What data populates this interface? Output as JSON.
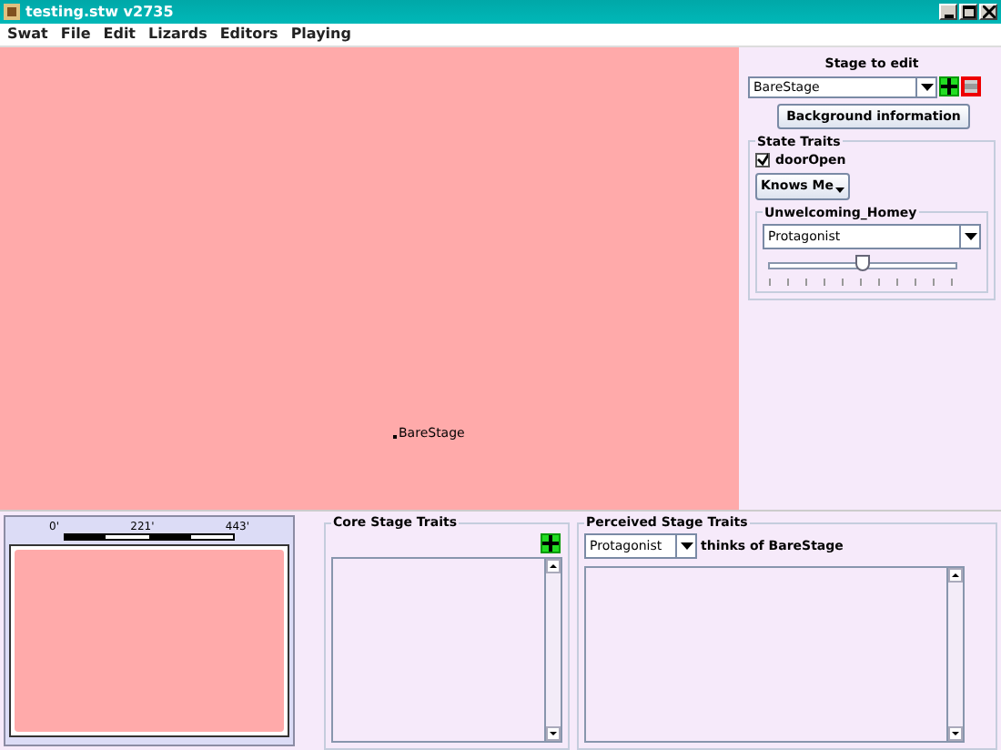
{
  "window": {
    "title": "testing.stw v2735"
  },
  "menu": [
    "Swat",
    "File",
    "Edit",
    "Lizards",
    "Editors",
    "Playing"
  ],
  "canvas": {
    "nodes": [
      {
        "label": "BareStage"
      }
    ]
  },
  "stage_panel": {
    "heading": "Stage to edit",
    "stage_value": "BareStage",
    "background_button": "Background information"
  },
  "state_traits": {
    "title": "State Traits",
    "checkbox": {
      "label": "doorOpen",
      "checked": true
    },
    "knows_button": "Knows Me",
    "trait": {
      "title": "Unwelcoming_Homey",
      "actor": "Protagonist",
      "level": 0.5
    }
  },
  "map": {
    "scale_labels": [
      "0'",
      "221'",
      "443'"
    ]
  },
  "core_traits": {
    "title": "Core Stage Traits"
  },
  "perceived_traits": {
    "title": "Perceived Stage Traits",
    "actor": "Protagonist",
    "caption": "thinks of BareStage"
  }
}
